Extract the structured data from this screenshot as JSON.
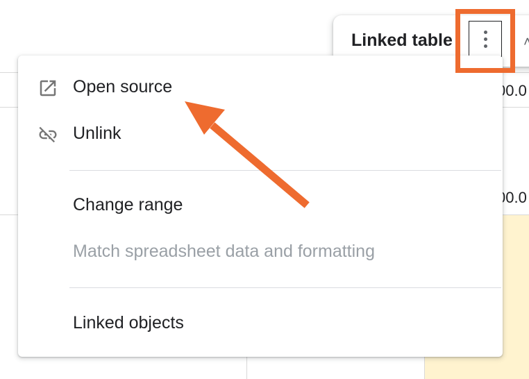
{
  "chip": {
    "title": "Linked table",
    "more_icon": "more-vert-icon"
  },
  "background": {
    "cell_values": [
      "00.0",
      "00.0"
    ]
  },
  "menu": {
    "items": [
      {
        "label": "Open source",
        "icon": "open-in-new-icon",
        "enabled": true
      },
      {
        "label": "Unlink",
        "icon": "link-off-icon",
        "enabled": true
      },
      {
        "label": "Change range",
        "enabled": true
      },
      {
        "label": "Match spreadsheet data and formatting",
        "enabled": false
      },
      {
        "label": "Linked objects",
        "enabled": true
      }
    ]
  },
  "annotation": {
    "color": "#ee6b2f"
  }
}
